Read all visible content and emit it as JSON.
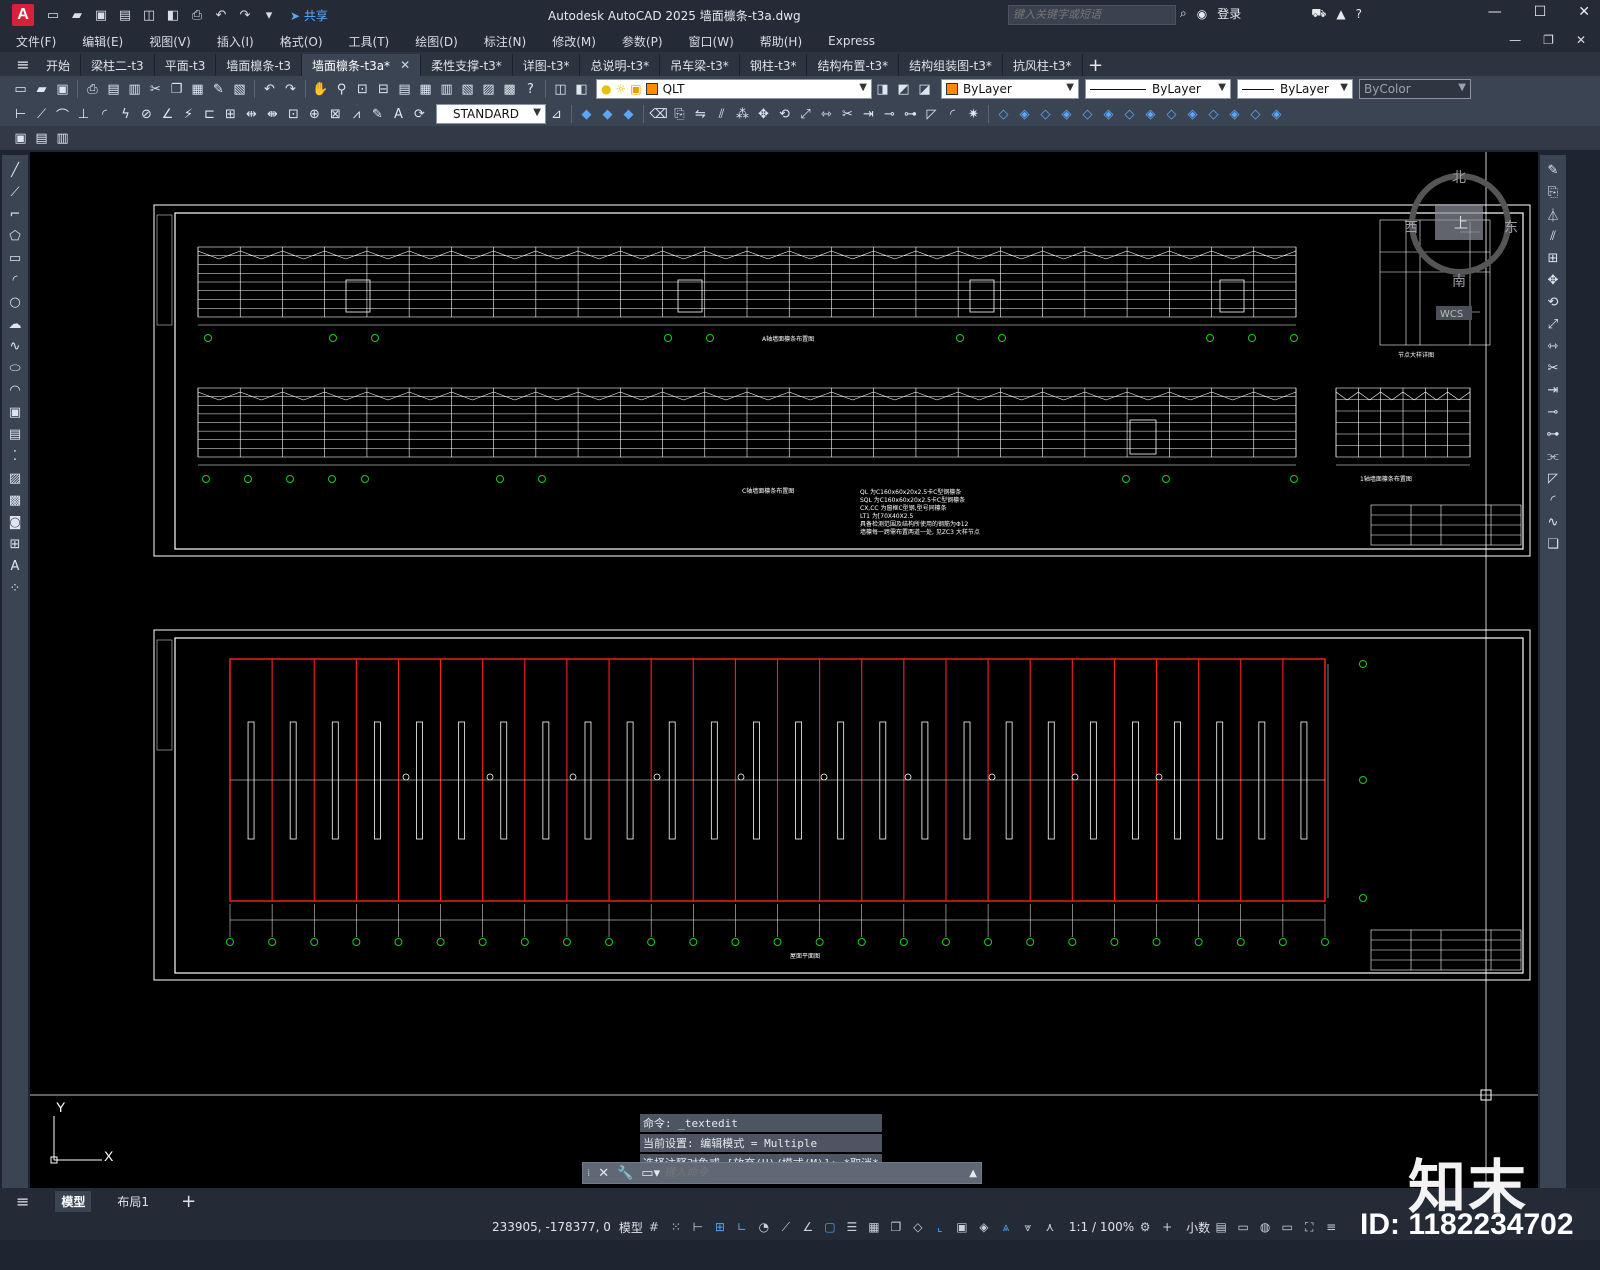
{
  "app": {
    "logo": "A",
    "title": "Autodesk AutoCAD 2025    墙面檩条-t3a.dwg",
    "share": "共享",
    "search_placeholder": "键入关键字或短语",
    "login": "登录"
  },
  "menu": [
    "文件(F)",
    "编辑(E)",
    "视图(V)",
    "插入(I)",
    "格式(O)",
    "工具(T)",
    "绘图(D)",
    "标注(N)",
    "修改(M)",
    "参数(P)",
    "窗口(W)",
    "帮助(H)",
    "Express"
  ],
  "tabs": [
    {
      "label": "开始",
      "active": false
    },
    {
      "label": "梁柱二-t3",
      "active": false
    },
    {
      "label": "平面-t3",
      "active": false
    },
    {
      "label": "墙面檩条-t3",
      "active": false
    },
    {
      "label": "墙面檩条-t3a*",
      "active": true
    },
    {
      "label": "柔性支撑-t3*",
      "active": false
    },
    {
      "label": "详图-t3*",
      "active": false
    },
    {
      "label": "总说明-t3*",
      "active": false
    },
    {
      "label": "吊车梁-t3*",
      "active": false
    },
    {
      "label": "钢柱-t3*",
      "active": false
    },
    {
      "label": "结构布置-t3*",
      "active": false
    },
    {
      "label": "结构组装图-t3*",
      "active": false
    },
    {
      "label": "抗风柱-t3*",
      "active": false
    }
  ],
  "props": {
    "layer": "QLT",
    "color": "ByLayer",
    "linetype": "ByLayer",
    "lineweight": "ByLayer",
    "plotstyle": "ByColor",
    "dimstyle": "STANDARD"
  },
  "viewcube": {
    "north": "北",
    "south": "南",
    "east": "东",
    "west": "西",
    "face": "上",
    "wcs": "WCS"
  },
  "drawing": {
    "elev_a_title": "A轴墙面檩条布置图",
    "elev_c_title": "C轴墙面檩条布置图",
    "elev_1_title": "1轴墙面檩条布置图",
    "section_title": "节点大样详图",
    "plan_title": "屋面平面图",
    "notes": [
      "QL 为C160x60x20x2.5卡C型钢檩条",
      "SQL 为C160x60x20x2.5卡C型钢檩条",
      "CX,CC 为窗框C型钢,型号同檩条",
      "LT1 为[70X40X2.5",
      "具备检测范围及结构所使用的钢筋为Φ12",
      "墙檩每一跨需布置两道一处, 见ZC3 大样节点"
    ]
  },
  "command": {
    "history": [
      "命令: _textedit",
      "当前设置: 编辑模式 = Multiple",
      "选择注释对象或 [放弃(U)/模式(M)]: *取消*"
    ],
    "placeholder": "键入命令"
  },
  "layouts": [
    {
      "label": "模型",
      "active": true
    },
    {
      "label": "布局1",
      "active": false
    }
  ],
  "status": {
    "coords": "233905, -178377, 0",
    "space": "模型",
    "scale": "1:1 / 100%",
    "units": "小数"
  },
  "overlay": {
    "brand": "知末",
    "id": "ID: 1182234702"
  },
  "colors": {
    "accent": "#4aa3ff",
    "logo": "#d8203a",
    "redline": "#ff2020",
    "gridbubble": "#1fcc1f"
  }
}
